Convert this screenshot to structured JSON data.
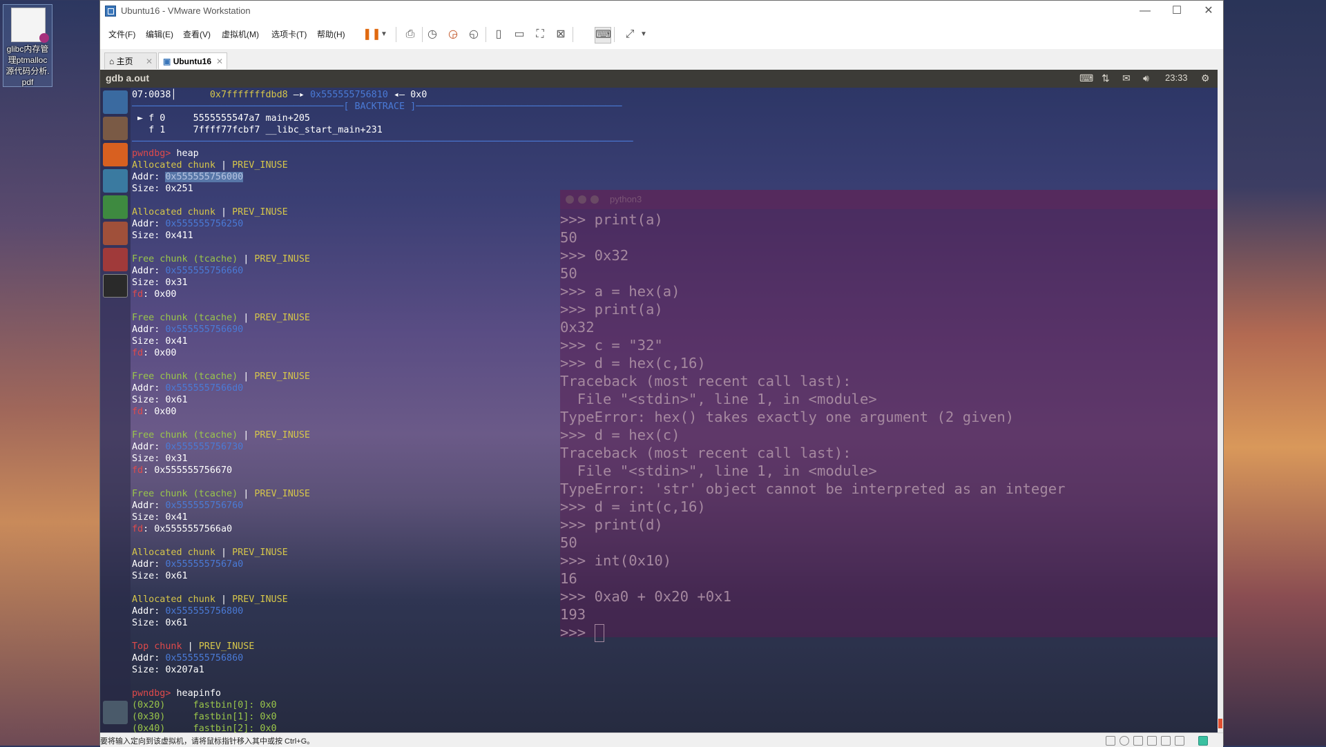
{
  "desktop": {
    "icon_label_lines": [
      "glibc内存管",
      "理ptmalloc",
      "源代码分析.",
      "pdf"
    ]
  },
  "window": {
    "title": "Ubuntu16 - VMware Workstation",
    "minimize": "—",
    "maximize": "☐",
    "close": "✕"
  },
  "menu": [
    "文件(F)",
    "编辑(E)",
    "查看(V)",
    "虚拟机(M)",
    "选项卡(T)",
    "帮助(H)"
  ],
  "toolbar_icons": [
    "pause-icon",
    "dropdown-icon",
    "send-ctrl-alt-del-icon",
    "snapshot-icon",
    "revert-snapshot-icon",
    "snapshot-manager-icon",
    "sidebar-icon",
    "thumbnail-icon",
    "fullscreen-icon",
    "unity-icon",
    "console-view-icon",
    "stretch-icon",
    "dropdown-icon"
  ],
  "tabs": [
    {
      "label": "主页",
      "icon": "home-icon",
      "close": "✕"
    },
    {
      "label": "Ubuntu16",
      "icon": "vm-icon",
      "close": "✕"
    }
  ],
  "guest": {
    "top_app": "gdb a.out",
    "clock": "23:33",
    "indicators": [
      "keyboard-icon",
      "network-icon",
      "mail-icon",
      "volume-icon",
      "settings-icon"
    ]
  },
  "launcher": [
    "ubuntu-dash-icon",
    "files-icon",
    "firefox-icon",
    "libreoffice-writer-icon",
    "libreoffice-calc-icon",
    "libreoffice-impress-icon",
    "system-settings-icon",
    "terminal-icon",
    "trash-icon"
  ],
  "terminal": {
    "lines": [
      [
        {
          "t": "07:0038│      ",
          "c": "wht"
        },
        {
          "t": "0x7fffffffdbd8",
          "c": "yel"
        },
        {
          "t": " —▸ ",
          "c": "wht"
        },
        {
          "t": "0x555555756810",
          "c": "blu"
        },
        {
          "t": " ◂— 0x0",
          "c": "wht"
        }
      ],
      [
        {
          "t": "──────────────────────────────────────[ BACKTRACE ]─────────────────────────────────────",
          "c": "blu"
        }
      ],
      [
        {
          "t": " ► f 0     5555555547a7 main+205",
          "c": "wht"
        }
      ],
      [
        {
          "t": "   f 1     7ffff77fcbf7 __libc_start_main+231",
          "c": "wht"
        }
      ],
      [
        {
          "t": "──────────────────────────────────────────────────────────────────────────────────────────",
          "c": "blu"
        }
      ],
      [
        {
          "t": "pwndbg> ",
          "c": "red"
        },
        {
          "t": "heap",
          "c": "wht"
        }
      ],
      [
        {
          "t": "Allocated chunk",
          "c": "yel"
        },
        {
          "t": " | ",
          "c": "wht"
        },
        {
          "t": "PREV_INUSE",
          "c": "yel"
        }
      ],
      [
        {
          "t": "Addr: ",
          "c": "wht"
        },
        {
          "t": "0x555555756000",
          "c": "sel"
        }
      ],
      [
        {
          "t": "Size: 0x251",
          "c": "wht"
        }
      ],
      [
        {
          "t": "",
          "c": "wht"
        }
      ],
      [
        {
          "t": "Allocated chunk",
          "c": "yel"
        },
        {
          "t": " | ",
          "c": "wht"
        },
        {
          "t": "PREV_INUSE",
          "c": "yel"
        }
      ],
      [
        {
          "t": "Addr: ",
          "c": "wht"
        },
        {
          "t": "0x555555756250",
          "c": "blu"
        }
      ],
      [
        {
          "t": "Size: 0x411",
          "c": "wht"
        }
      ],
      [
        {
          "t": "",
          "c": "wht"
        }
      ],
      [
        {
          "t": "Free chunk (tcache)",
          "c": "grn"
        },
        {
          "t": " | ",
          "c": "wht"
        },
        {
          "t": "PREV_INUSE",
          "c": "yel"
        }
      ],
      [
        {
          "t": "Addr: ",
          "c": "wht"
        },
        {
          "t": "0x555555756660",
          "c": "blu"
        }
      ],
      [
        {
          "t": "Size: 0x31",
          "c": "wht"
        }
      ],
      [
        {
          "t": "fd",
          "c": "red"
        },
        {
          "t": ": 0x00",
          "c": "wht"
        }
      ],
      [
        {
          "t": "",
          "c": "wht"
        }
      ],
      [
        {
          "t": "Free chunk (tcache)",
          "c": "grn"
        },
        {
          "t": " | ",
          "c": "wht"
        },
        {
          "t": "PREV_INUSE",
          "c": "yel"
        }
      ],
      [
        {
          "t": "Addr: ",
          "c": "wht"
        },
        {
          "t": "0x555555756690",
          "c": "blu"
        }
      ],
      [
        {
          "t": "Size: 0x41",
          "c": "wht"
        }
      ],
      [
        {
          "t": "fd",
          "c": "red"
        },
        {
          "t": ": 0x00",
          "c": "wht"
        }
      ],
      [
        {
          "t": "",
          "c": "wht"
        }
      ],
      [
        {
          "t": "Free chunk (tcache)",
          "c": "grn"
        },
        {
          "t": " | ",
          "c": "wht"
        },
        {
          "t": "PREV_INUSE",
          "c": "yel"
        }
      ],
      [
        {
          "t": "Addr: ",
          "c": "wht"
        },
        {
          "t": "0x5555557566d0",
          "c": "blu"
        }
      ],
      [
        {
          "t": "Size: 0x61",
          "c": "wht"
        }
      ],
      [
        {
          "t": "fd",
          "c": "red"
        },
        {
          "t": ": 0x00",
          "c": "wht"
        }
      ],
      [
        {
          "t": "",
          "c": "wht"
        }
      ],
      [
        {
          "t": "Free chunk (tcache)",
          "c": "grn"
        },
        {
          "t": " | ",
          "c": "wht"
        },
        {
          "t": "PREV_INUSE",
          "c": "yel"
        }
      ],
      [
        {
          "t": "Addr: ",
          "c": "wht"
        },
        {
          "t": "0x555555756730",
          "c": "blu"
        }
      ],
      [
        {
          "t": "Size: 0x31",
          "c": "wht"
        }
      ],
      [
        {
          "t": "fd",
          "c": "red"
        },
        {
          "t": ": 0x555555756670",
          "c": "wht"
        }
      ],
      [
        {
          "t": "",
          "c": "wht"
        }
      ],
      [
        {
          "t": "Free chunk (tcache)",
          "c": "grn"
        },
        {
          "t": " | ",
          "c": "wht"
        },
        {
          "t": "PREV_INUSE",
          "c": "yel"
        }
      ],
      [
        {
          "t": "Addr: ",
          "c": "wht"
        },
        {
          "t": "0x555555756760",
          "c": "blu"
        }
      ],
      [
        {
          "t": "Size: 0x41",
          "c": "wht"
        }
      ],
      [
        {
          "t": "fd",
          "c": "red"
        },
        {
          "t": ": 0x5555557566a0",
          "c": "wht"
        }
      ],
      [
        {
          "t": "",
          "c": "wht"
        }
      ],
      [
        {
          "t": "Allocated chunk",
          "c": "yel"
        },
        {
          "t": " | ",
          "c": "wht"
        },
        {
          "t": "PREV_INUSE",
          "c": "yel"
        }
      ],
      [
        {
          "t": "Addr: ",
          "c": "wht"
        },
        {
          "t": "0x5555557567a0",
          "c": "blu"
        }
      ],
      [
        {
          "t": "Size: 0x61",
          "c": "wht"
        }
      ],
      [
        {
          "t": "",
          "c": "wht"
        }
      ],
      [
        {
          "t": "Allocated chunk",
          "c": "yel"
        },
        {
          "t": " | ",
          "c": "wht"
        },
        {
          "t": "PREV_INUSE",
          "c": "yel"
        }
      ],
      [
        {
          "t": "Addr: ",
          "c": "wht"
        },
        {
          "t": "0x555555756800",
          "c": "blu"
        }
      ],
      [
        {
          "t": "Size: 0x61",
          "c": "wht"
        }
      ],
      [
        {
          "t": "",
          "c": "wht"
        }
      ],
      [
        {
          "t": "Top chunk",
          "c": "red"
        },
        {
          "t": " | ",
          "c": "wht"
        },
        {
          "t": "PREV_INUSE",
          "c": "yel"
        }
      ],
      [
        {
          "t": "Addr: ",
          "c": "wht"
        },
        {
          "t": "0x555555756860",
          "c": "blu"
        }
      ],
      [
        {
          "t": "Size: 0x207a1",
          "c": "wht"
        }
      ],
      [
        {
          "t": "",
          "c": "wht"
        }
      ],
      [
        {
          "t": "pwndbg> ",
          "c": "red"
        },
        {
          "t": "heapinfo",
          "c": "wht"
        }
      ],
      [
        {
          "t": "(0x20)     fastbin[0]: 0x0",
          "c": "grn"
        }
      ],
      [
        {
          "t": "(0x30)     fastbin[1]: 0x0",
          "c": "grn"
        }
      ],
      [
        {
          "t": "(0x40)     fastbin[2]: 0x0",
          "c": "grn"
        }
      ]
    ]
  },
  "python": {
    "title": "python3",
    "lines": [
      ">>> print(a)",
      "50",
      ">>> 0x32",
      "50",
      ">>> a = hex(a)",
      ">>> print(a)",
      "0x32",
      ">>> c = \"32\"",
      ">>> d = hex(c,16)",
      "Traceback (most recent call last):",
      "  File \"<stdin>\", line 1, in <module>",
      "TypeError: hex() takes exactly one argument (2 given)",
      ">>> d = hex(c)",
      "Traceback (most recent call last):",
      "  File \"<stdin>\", line 1, in <module>",
      "TypeError: 'str' object cannot be interpreted as an integer",
      ">>> d = int(c,16)",
      ">>> print(d)",
      "50",
      ">>> int(0x10)",
      "16",
      ">>> 0xa0 + 0x20 +0x1",
      "193"
    ],
    "prompt": ">>> "
  },
  "statusbar": {
    "message": "要将输入定向到该虚拟机，请将鼠标指针移入其中或按 Ctrl+G。"
  }
}
